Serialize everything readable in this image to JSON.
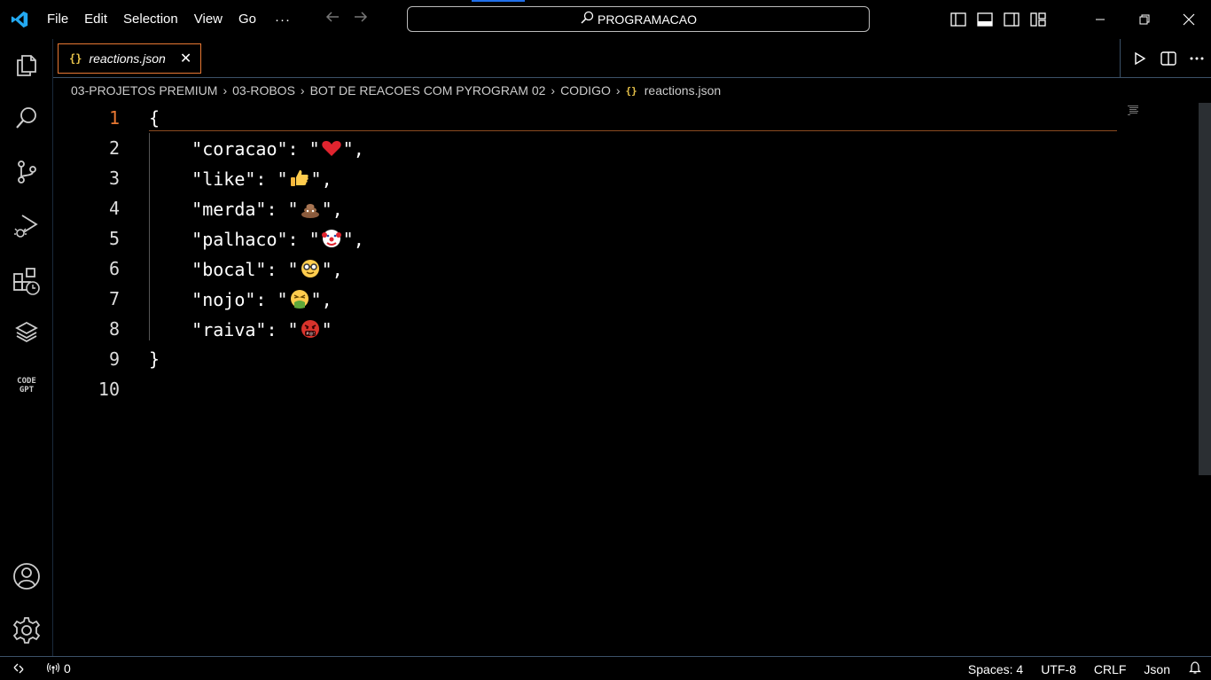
{
  "titlebar": {
    "menu": [
      "File",
      "Edit",
      "Selection",
      "View",
      "Go"
    ],
    "more": "···",
    "search_text": "PROGRAMACAO"
  },
  "tab": {
    "icon": "{}",
    "name": "reactions.json",
    "close": "✕"
  },
  "breadcrumb": {
    "items": [
      "03-PROJETOS PREMIUM",
      "03-ROBOS",
      "BOT DE REACOES COM PYROGRAM 02",
      "CODIGO"
    ],
    "file_icon": "{}",
    "file": "reactions.json",
    "separator": "›"
  },
  "editor": {
    "active_line": 1,
    "lines": [
      {
        "num": "1",
        "text": "{"
      },
      {
        "num": "2",
        "key": "\"coracao\": \"",
        "emoji": "heart",
        "end": "\","
      },
      {
        "num": "3",
        "key": "\"like\": \"",
        "emoji": "thumbs-up",
        "end": "\","
      },
      {
        "num": "4",
        "key": "\"merda\": \"",
        "emoji": "poop",
        "end": "\","
      },
      {
        "num": "5",
        "key": "\"palhaco\": \"",
        "emoji": "clown",
        "end": "\","
      },
      {
        "num": "6",
        "key": "\"bocal\": \"",
        "emoji": "nerd",
        "end": "\","
      },
      {
        "num": "7",
        "key": "\"nojo\": \"",
        "emoji": "vomit",
        "end": "\","
      },
      {
        "num": "8",
        "key": "\"raiva\": \"",
        "emoji": "cursing",
        "end": "\""
      },
      {
        "num": "9",
        "text": "}"
      },
      {
        "num": "10",
        "text": ""
      }
    ]
  },
  "statusbar": {
    "ports": "0",
    "spaces": "Spaces: 4",
    "encoding": "UTF-8",
    "eol": "CRLF",
    "language": "Json"
  },
  "colors": {
    "accent_orange": "#e87833",
    "vscode_blue": "#23a9f2",
    "json_braces": "#e8c34a"
  }
}
